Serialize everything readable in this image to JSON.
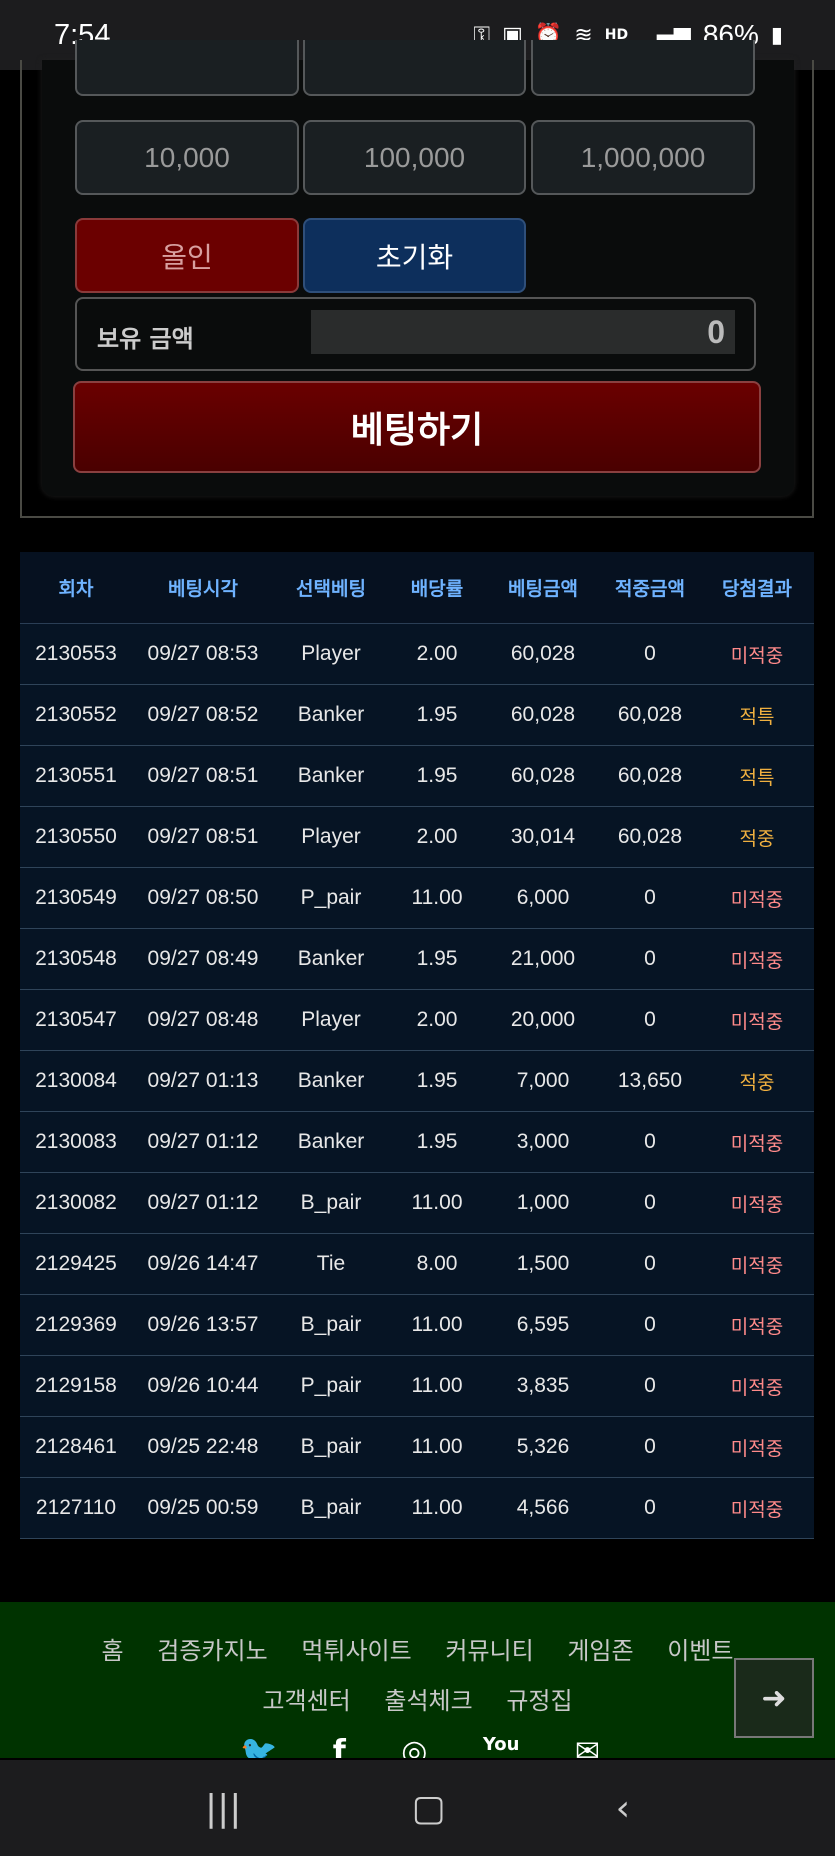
{
  "status_bar": {
    "time": "7:54",
    "network": "HD",
    "battery": "86%"
  },
  "amounts": {
    "row1": [
      "10,000",
      "100,000",
      "1,000,000"
    ]
  },
  "controls": {
    "allin_label": "올인",
    "reset_label": "초기화",
    "holding_label": "보유 금액",
    "holding_value": "0",
    "bet_label": "베팅하기"
  },
  "history": {
    "headers": [
      "회차",
      "베팅시각",
      "선택베팅",
      "배당률",
      "베팅금액",
      "적중금액",
      "당첨결과"
    ],
    "rows": [
      [
        "2130553",
        "09/27 08:53",
        "Player",
        "2.00",
        "60,028",
        "0",
        "미적중"
      ],
      [
        "2130552",
        "09/27 08:52",
        "Banker",
        "1.95",
        "60,028",
        "60,028",
        "적특"
      ],
      [
        "2130551",
        "09/27 08:51",
        "Banker",
        "1.95",
        "60,028",
        "60,028",
        "적특"
      ],
      [
        "2130550",
        "09/27 08:51",
        "Player",
        "2.00",
        "30,014",
        "60,028",
        "적중"
      ],
      [
        "2130549",
        "09/27 08:50",
        "P_pair",
        "11.00",
        "6,000",
        "0",
        "미적중"
      ],
      [
        "2130548",
        "09/27 08:49",
        "Banker",
        "1.95",
        "21,000",
        "0",
        "미적중"
      ],
      [
        "2130547",
        "09/27 08:48",
        "Player",
        "2.00",
        "20,000",
        "0",
        "미적중"
      ],
      [
        "2130084",
        "09/27 01:13",
        "Banker",
        "1.95",
        "7,000",
        "13,650",
        "적중"
      ],
      [
        "2130083",
        "09/27 01:12",
        "Banker",
        "1.95",
        "3,000",
        "0",
        "미적중"
      ],
      [
        "2130082",
        "09/27 01:12",
        "B_pair",
        "11.00",
        "1,000",
        "0",
        "미적중"
      ],
      [
        "2129425",
        "09/26 14:47",
        "Tie",
        "8.00",
        "1,500",
        "0",
        "미적중"
      ],
      [
        "2129369",
        "09/26 13:57",
        "B_pair",
        "11.00",
        "6,595",
        "0",
        "미적중"
      ],
      [
        "2129158",
        "09/26 10:44",
        "P_pair",
        "11.00",
        "3,835",
        "0",
        "미적중"
      ],
      [
        "2128461",
        "09/25 22:48",
        "B_pair",
        "11.00",
        "5,326",
        "0",
        "미적중"
      ],
      [
        "2127110",
        "09/25 00:59",
        "B_pair",
        "11.00",
        "4,566",
        "0",
        "미적중"
      ]
    ]
  },
  "footer": {
    "nav_row1": [
      "홈",
      "검증카지노",
      "먹튀사이트",
      "커뮤니티",
      "게임존",
      "이벤트"
    ],
    "nav_row2": [
      "고객센터",
      "출석체크",
      "규정집"
    ],
    "social": [
      "twitter-icon",
      "facebook-icon",
      "instagram-icon",
      "youtube-icon",
      "mail-icon"
    ],
    "youtube_text": "You"
  },
  "colors": {
    "miss": "#ff8a8a",
    "hit": "#f0b040",
    "header_blue": "#6fb3ff",
    "footer_green": "#003300"
  }
}
